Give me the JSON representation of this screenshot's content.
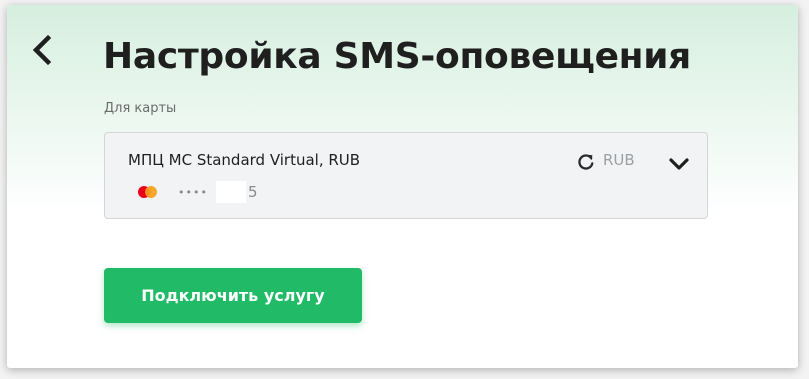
{
  "header": {
    "back_icon": "chevron-left-icon",
    "title": "Настройка SMS-оповещения"
  },
  "card_section": {
    "label": "Для карты",
    "card": {
      "name": "МПЦ MC Standard Virtual, RUB",
      "network_icon": "mastercard-icon",
      "masked_dots": "••••",
      "last_digit": "5",
      "currency": "RUB",
      "refresh_icon": "refresh-icon",
      "dropdown_icon": "chevron-down-icon"
    }
  },
  "actions": {
    "connect_label": "Подключить услугу"
  },
  "colors": {
    "accent": "#21bb68",
    "header_tint": "#d6efdf",
    "mastercard_red": "#eb001b",
    "mastercard_orange": "#f79e1b"
  }
}
